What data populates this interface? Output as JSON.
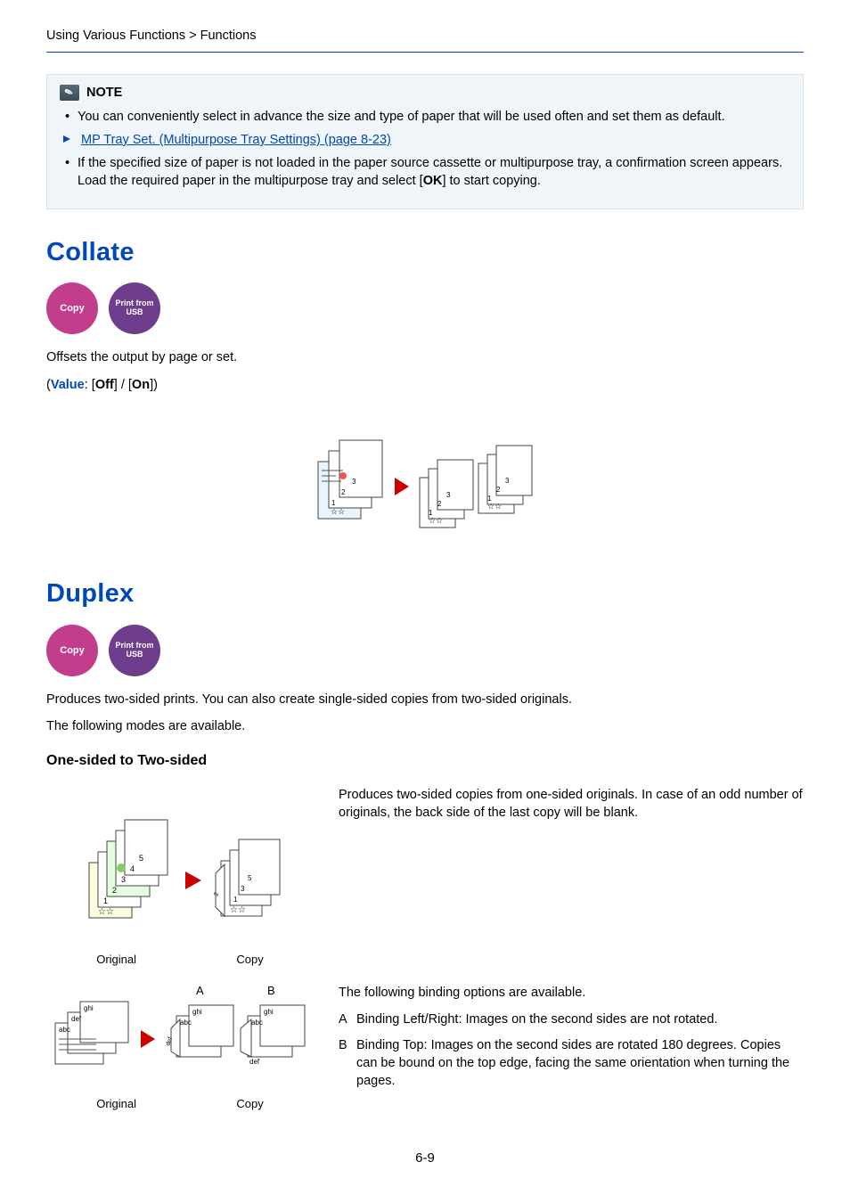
{
  "breadcrumb": "Using Various Functions > Functions",
  "note": {
    "label": "NOTE",
    "bullet1": "You can conveniently select in advance the size and type of paper that will be used often and set them as default.",
    "link": "MP Tray Set. (Multipurpose Tray Settings) (page 8-23)",
    "bullet2_pre": "If the specified size of paper is not loaded in the paper source cassette or multipurpose tray, a confirmation screen appears. Load the required paper in the multipurpose tray and select [",
    "bullet2_ok": "OK",
    "bullet2_post": "] to start copying."
  },
  "collate": {
    "title": "Collate",
    "badge_copy": "Copy",
    "badge_usb": "Print from USB",
    "desc": "Offsets the output by page or set.",
    "value": {
      "open": "(",
      "label": "Value",
      "sep": ": [",
      "off": "Off",
      "mid": "] / [",
      "on": "On",
      "close": "])"
    }
  },
  "duplex": {
    "title": "Duplex",
    "badge_copy": "Copy",
    "badge_usb": "Print from USB",
    "desc1": "Produces two-sided prints. You can also create single-sided copies from two-sided originals.",
    "desc2": "The following modes are available.",
    "sub1": "One-sided to Two-sided",
    "sub1_desc": "Produces two-sided copies from one-sided originals. In case of an odd number of originals, the back side of the last copy will be blank.",
    "original_label": "Original",
    "copy_label": "Copy",
    "a": "A",
    "b": "B",
    "binding_intro": "The following binding options are available.",
    "binding_a_label": "A",
    "binding_a_text": "Binding Left/Right: Images on the second sides are not rotated.",
    "binding_b_label": "B",
    "binding_b_text": "Binding Top: Images on the second sides are rotated 180 degrees. Copies can be bound on the top edge, facing the same orientation when turning the pages.",
    "fig_labels": {
      "abc": "abc",
      "def": "def",
      "ghi": "ghi"
    }
  },
  "page_number": "6-9"
}
